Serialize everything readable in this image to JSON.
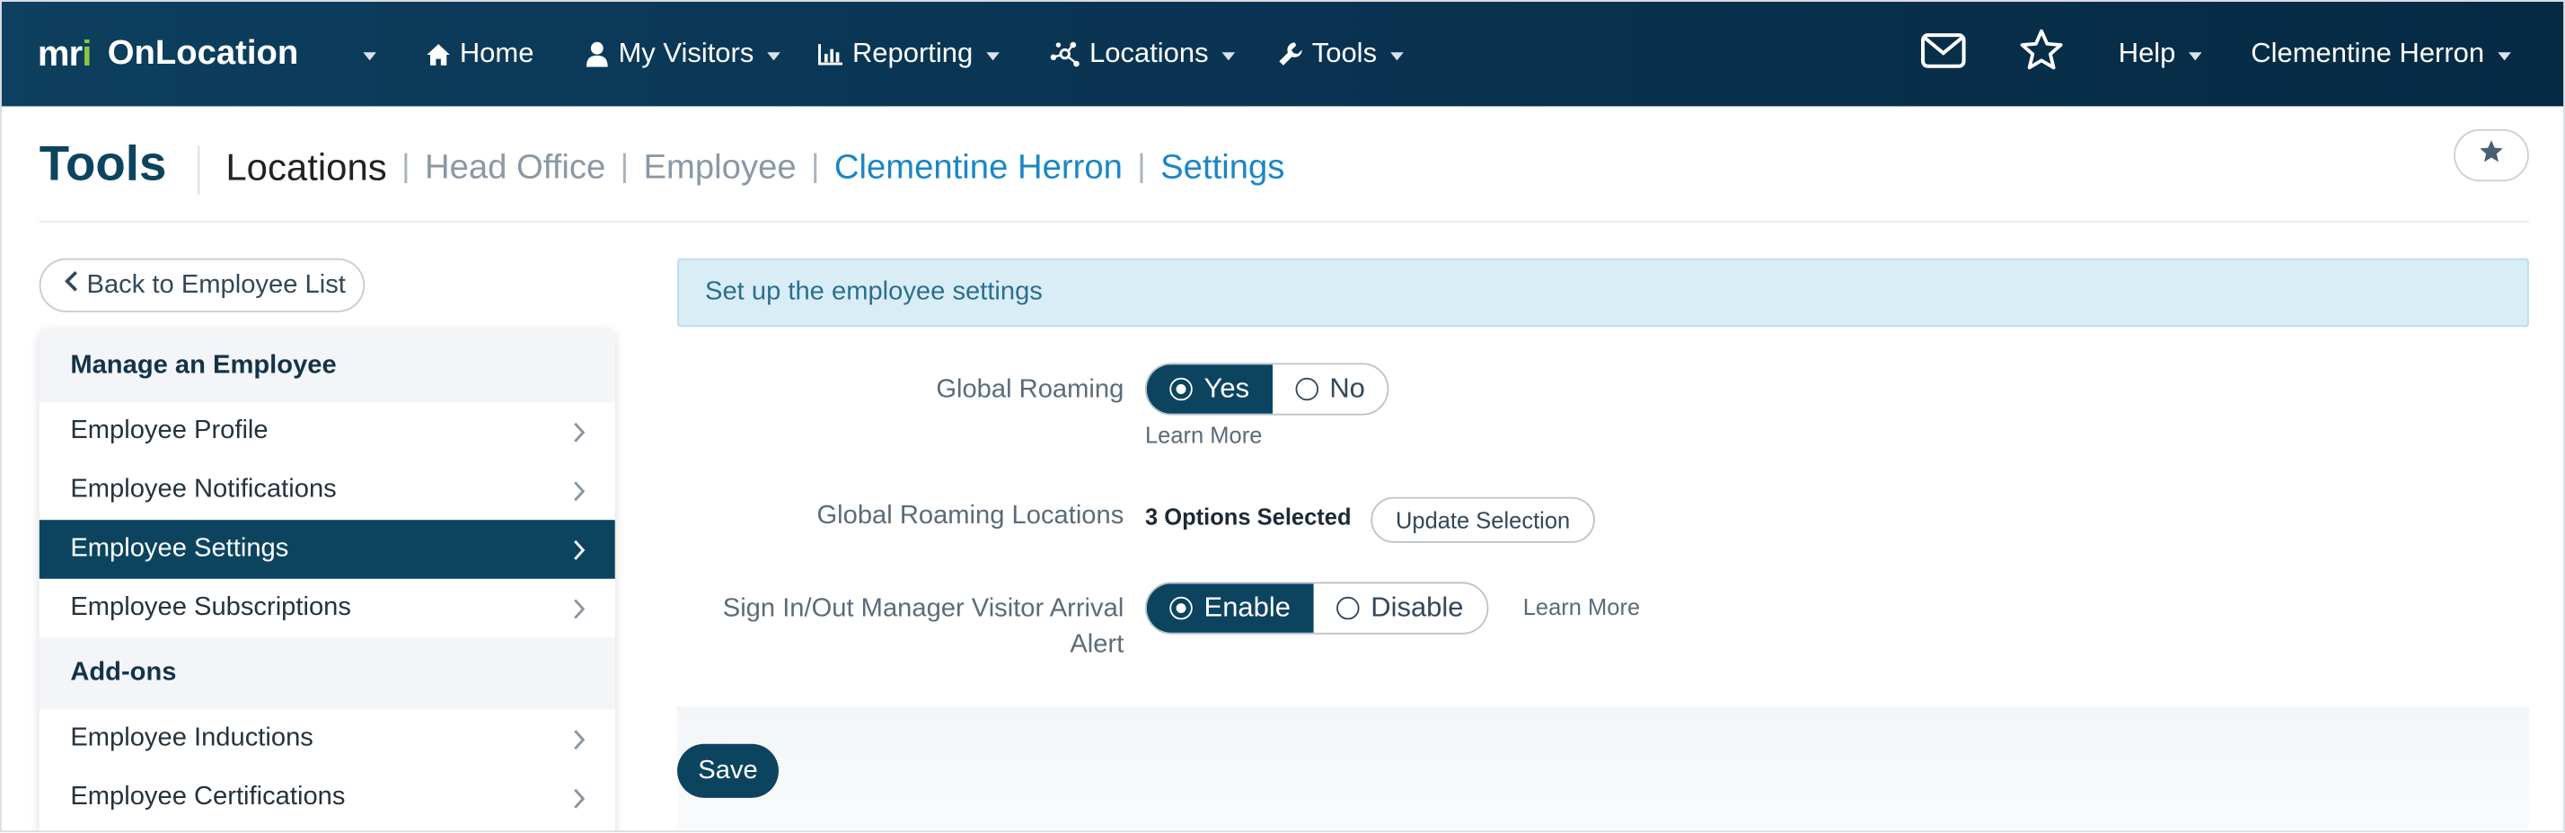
{
  "nav": {
    "brand_mark": "mri",
    "brand_name": "OnLocation",
    "home": "Home",
    "my_visitors": "My Visitors",
    "reporting": "Reporting",
    "locations": "Locations",
    "tools": "Tools",
    "help": "Help",
    "user": "Clementine Herron",
    "icons": [
      "home-icon",
      "user-icon",
      "bar-chart-icon",
      "network-icon",
      "wrench-icon",
      "envelope-icon",
      "star-icon"
    ]
  },
  "header": {
    "title": "Tools",
    "breadcrumb": {
      "locations": "Locations",
      "head_office": "Head Office",
      "employee": "Employee",
      "person": "Clementine Herron",
      "settings": "Settings",
      "separator": "|"
    }
  },
  "sidebar": {
    "back_label": "Back to Employee List",
    "section_manage": "Manage an Employee",
    "items_manage": [
      {
        "label": "Employee Profile"
      },
      {
        "label": "Employee Notifications"
      },
      {
        "label": "Employee Settings",
        "active": true
      },
      {
        "label": "Employee Subscriptions"
      }
    ],
    "section_addons": "Add-ons",
    "items_addons": [
      {
        "label": "Employee Inductions"
      },
      {
        "label": "Employee Certifications"
      }
    ]
  },
  "main": {
    "banner": "Set up the employee settings",
    "global_roaming": {
      "label": "Global Roaming",
      "yes": "Yes",
      "no": "No",
      "selected": "Yes",
      "learn_more": "Learn More"
    },
    "roaming_locations": {
      "label": "Global Roaming Locations",
      "value": "3 Options Selected",
      "button": "Update Selection"
    },
    "arrival_alert": {
      "label_line1": "Sign In/Out Manager Visitor Arrival",
      "label_line2": "Alert",
      "enable": "Enable",
      "disable": "Disable",
      "selected": "Enable",
      "learn_more": "Learn More"
    },
    "save": "Save"
  },
  "colors": {
    "nav_bg": "#0a3553",
    "accent_dark": "#0c4460",
    "link_blue": "#1a86c7",
    "banner_bg": "#d9edf6",
    "brand_green": "#8cc63f"
  }
}
